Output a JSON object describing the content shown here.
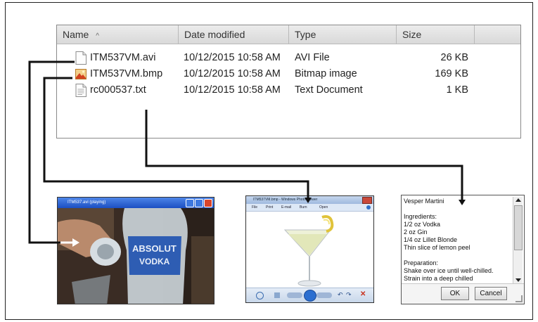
{
  "columns": {
    "name": "Name",
    "sort_glyph": "^",
    "date": "Date modified",
    "type": "Type",
    "size": "Size"
  },
  "files": [
    {
      "name": "ITM537VM.avi",
      "date": "10/12/2015 10:58 AM",
      "type": "AVI File",
      "size": "26 KB",
      "icon": "video-file-icon"
    },
    {
      "name": "ITM537VM.bmp",
      "date": "10/12/2015 10:58 AM",
      "type": "Bitmap image",
      "size": "169 KB",
      "icon": "image-file-icon"
    },
    {
      "name": "rc000537.txt",
      "date": "10/12/2015 10:58 AM",
      "type": "Text Document",
      "size": "1 KB",
      "icon": "text-file-icon"
    }
  ],
  "video_window": {
    "title": "ITM537.avi (playing)"
  },
  "photo_viewer": {
    "title": "ITM537VM.bmp - Windows Photo Viewer",
    "menu": [
      "File",
      "Print",
      "E-mail",
      "Burn",
      "Open"
    ]
  },
  "text_dialog": {
    "lines": [
      "Vesper Martini",
      "",
      "Ingredients:",
      "1/2 oz Vodka",
      "2 oz Gin",
      "1/4 oz Lillet Blonde",
      "Thin slice of lemon peel",
      "",
      "Preparation:",
      "Shake over ice until well-chilled.",
      "Strain into a deep chilled"
    ],
    "ok_label": "OK",
    "cancel_label": "Cancel"
  },
  "colors": {
    "arrow": "#111111",
    "title_bar": "#1b4fc2",
    "title_bar_light": "#4d85e8"
  }
}
